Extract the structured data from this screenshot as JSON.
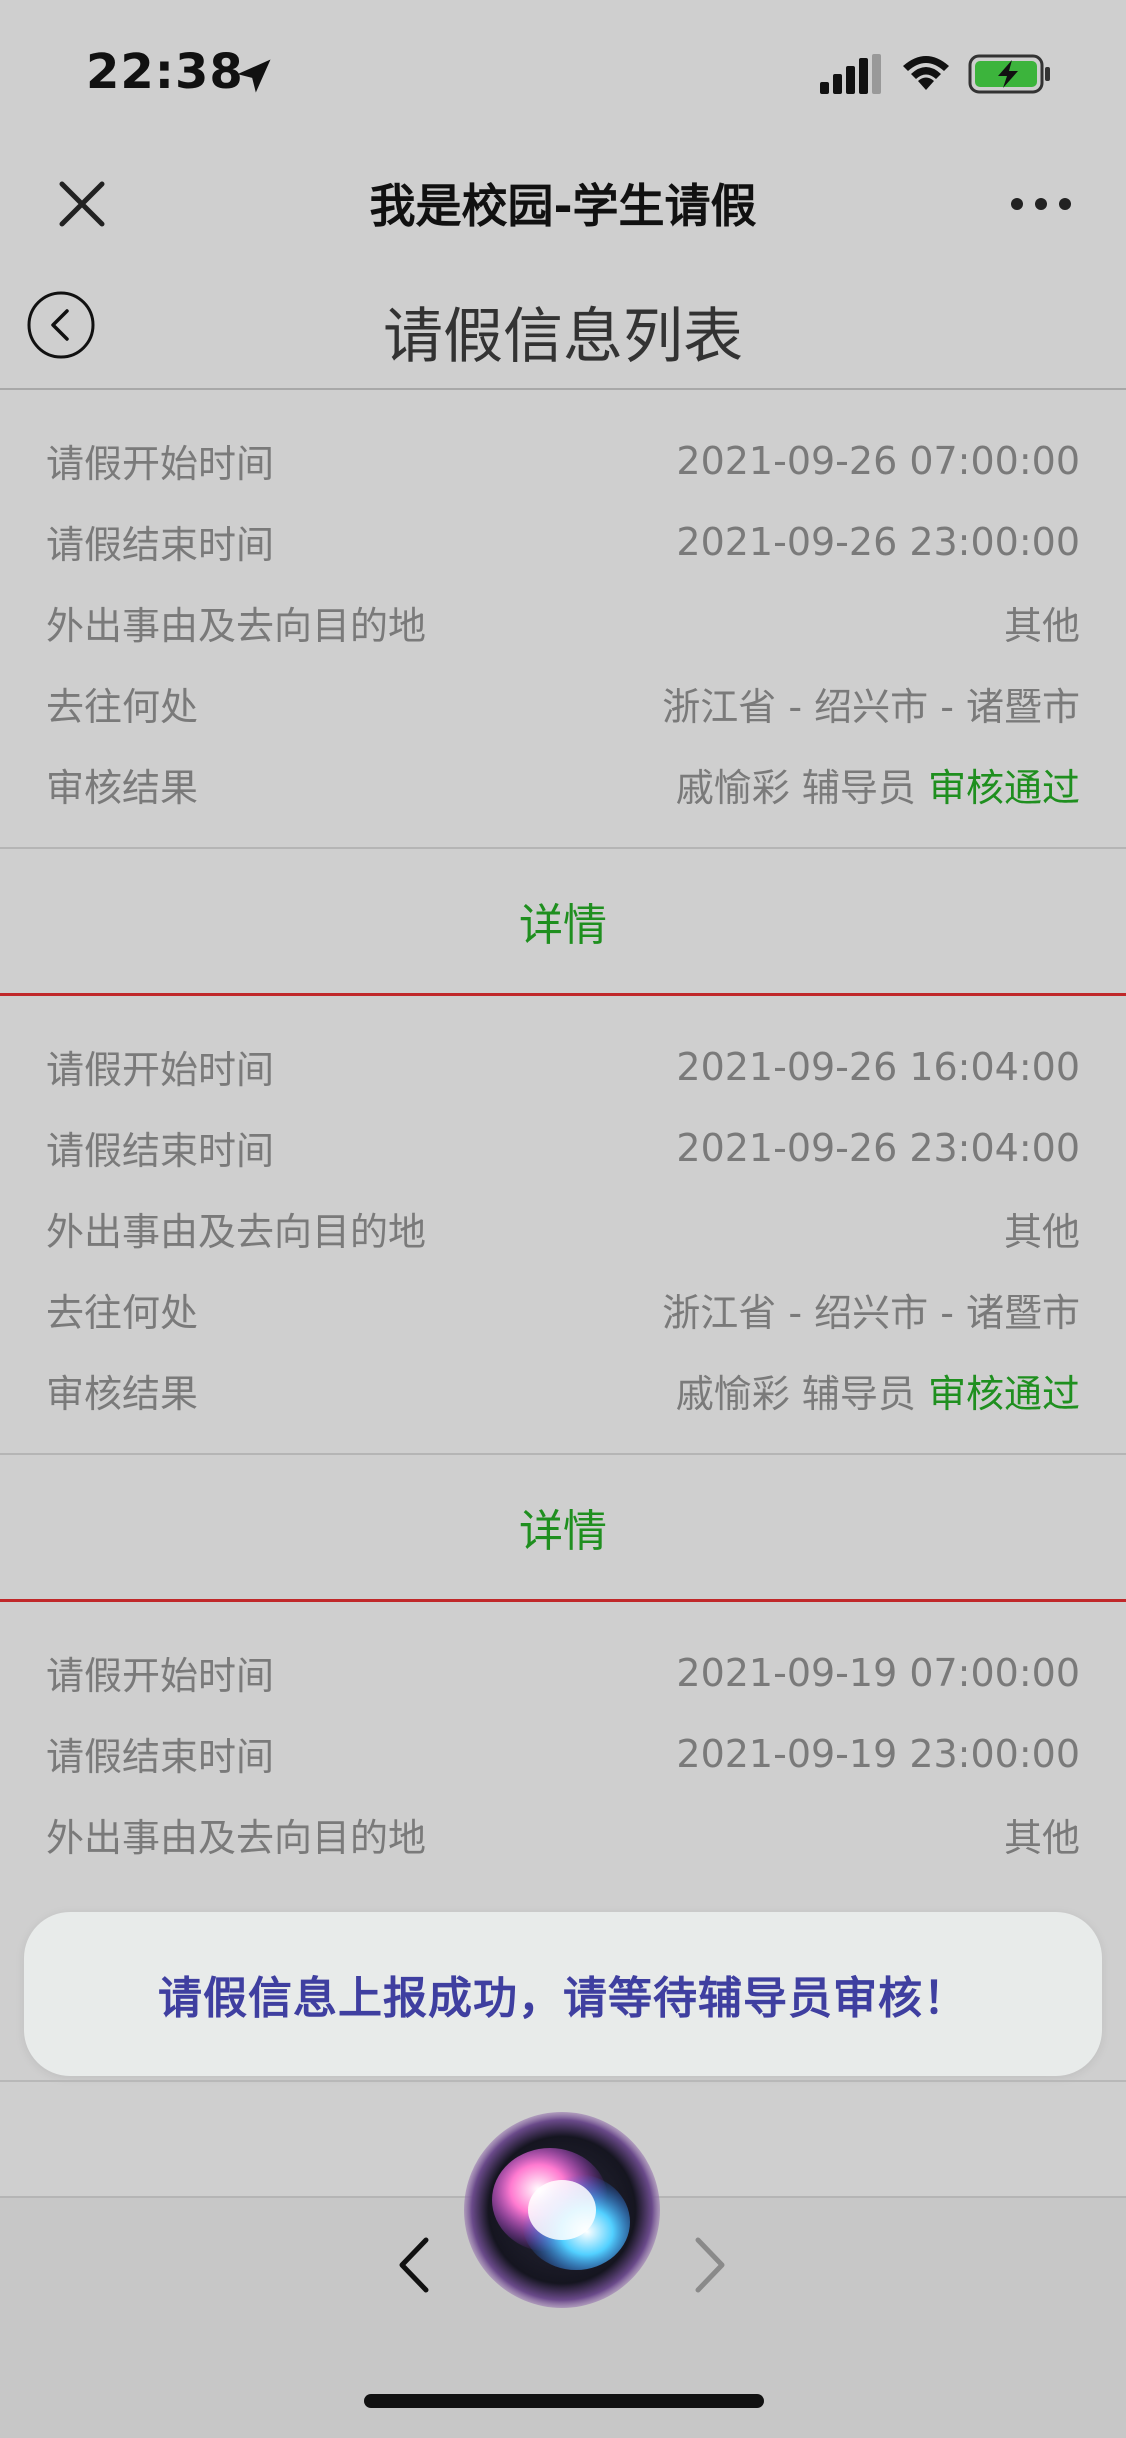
{
  "status_bar": {
    "time": "22:38"
  },
  "title_bar": {
    "title": "我是校园-学生请假"
  },
  "page": {
    "title": "请假信息列表"
  },
  "labels": {
    "start_time": "请假开始时间",
    "end_time": "请假结束时间",
    "reason": "外出事由及去向目的地",
    "destination": "去往何处",
    "review": "审核结果"
  },
  "records": [
    {
      "start_time": "2021-09-26 07:00:00",
      "end_time": "2021-09-26 23:00:00",
      "reason": "其他",
      "destination": "浙江省 - 绍兴市 - 诸暨市",
      "reviewer": "戚愉彩 辅导员",
      "status": "审核通过",
      "detail_label": "详情"
    },
    {
      "start_time": "2021-09-26 16:04:00",
      "end_time": "2021-09-26 23:04:00",
      "reason": "其他",
      "destination": "浙江省 - 绍兴市 - 诸暨市",
      "reviewer": "戚愉彩 辅导员",
      "status": "审核通过",
      "detail_label": "详情"
    },
    {
      "start_time": "2021-09-19 07:00:00",
      "end_time": "2021-09-19 23:00:00",
      "reason": "其他"
    }
  ],
  "toast": {
    "message": "请假信息上报成功，请等待辅导员审核！"
  },
  "colors": {
    "accent_green": "#1f8f1f",
    "divider_red": "#c0282a",
    "toast_text": "#3f3fa0"
  },
  "icons": [
    "location-arrow-icon",
    "signal-icon",
    "wifi-icon",
    "battery-charging-icon",
    "close-icon",
    "more-icon",
    "back-icon",
    "siri-icon",
    "chevron-left-icon",
    "chevron-right-icon"
  ]
}
